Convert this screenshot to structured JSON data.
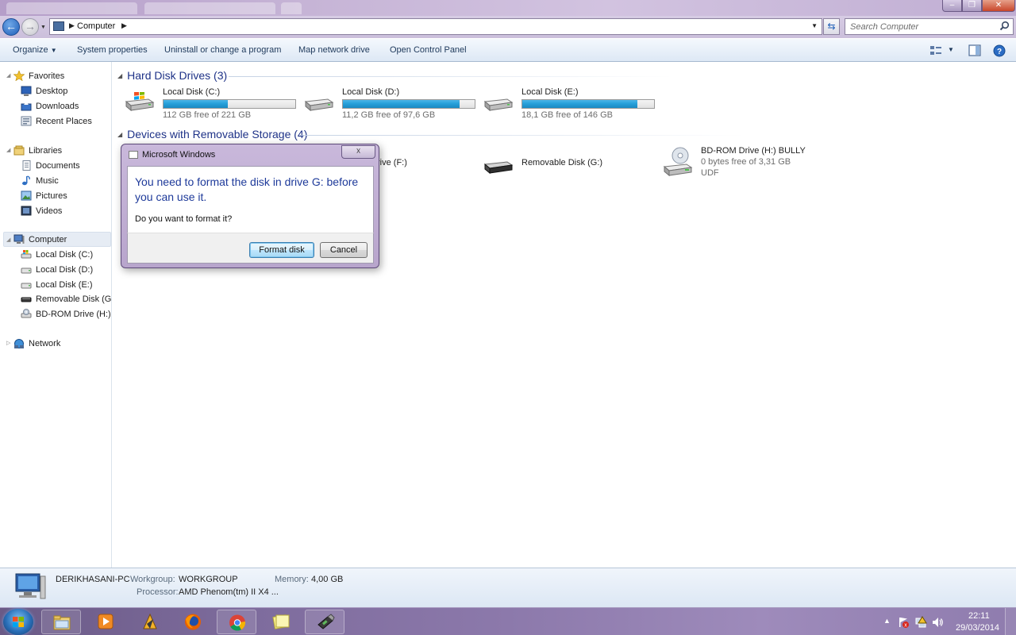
{
  "window": {
    "address": {
      "path": "Computer"
    },
    "search": {
      "placeholder": "Search Computer"
    }
  },
  "toolbar": {
    "organize": "Organize",
    "system_properties": "System properties",
    "uninstall": "Uninstall or change a program",
    "map_drive": "Map network drive",
    "control_panel": "Open Control Panel"
  },
  "sidebar": {
    "favorites": "Favorites",
    "desktop": "Desktop",
    "downloads": "Downloads",
    "recent": "Recent Places",
    "libraries": "Libraries",
    "documents": "Documents",
    "music": "Music",
    "pictures": "Pictures",
    "videos": "Videos",
    "computer": "Computer",
    "disk_c": "Local Disk (C:)",
    "disk_d": "Local Disk (D:)",
    "disk_e": "Local Disk (E:)",
    "disk_g": "Removable Disk (G:)",
    "disk_h": "BD-ROM Drive (H:) BULLY",
    "network": "Network"
  },
  "main": {
    "hdd_group": "Hard Disk Drives (3)",
    "removable_group": "Devices with Removable Storage (4)",
    "drives": [
      {
        "name": "Local Disk (C:)",
        "free": "112 GB free of 221 GB",
        "used_fraction": 0.49
      },
      {
        "name": "Local Disk (D:)",
        "free": "11,2 GB free of 97,6 GB",
        "used_fraction": 0.885
      },
      {
        "name": "Local Disk (E:)",
        "free": "18,1 GB free of 146 GB",
        "used_fraction": 0.876
      }
    ],
    "removable": [
      {
        "name": "rive (F:)"
      },
      {
        "name": "Removable Disk (G:)"
      },
      {
        "name": "BD-ROM Drive (H:) BULLY",
        "free": "0 bytes free of 3,31 GB",
        "fs": "UDF"
      }
    ]
  },
  "dialog": {
    "title": "Microsoft Windows",
    "close": "☓",
    "message": "You need to format the disk in drive G: before you can use it.",
    "question": "Do you want to format it?",
    "format_button": "Format disk",
    "cancel_button": "Cancel"
  },
  "details": {
    "pc_name": "DERIKHASANI-PC",
    "workgroup_label": "Workgroup:",
    "workgroup": "WORKGROUP",
    "memory_label": "Memory:",
    "memory": "4,00 GB",
    "processor_label": "Processor:",
    "processor": "AMD Phenom(tm) II X4 ..."
  },
  "taskbar": {
    "time": "22:11",
    "date": "29/03/2014"
  },
  "colors": {
    "group_heading": "#1e3287",
    "progress_fill": "#26a0da",
    "dialog_message": "#1e3a9a",
    "frame": "#c6b4d6"
  }
}
